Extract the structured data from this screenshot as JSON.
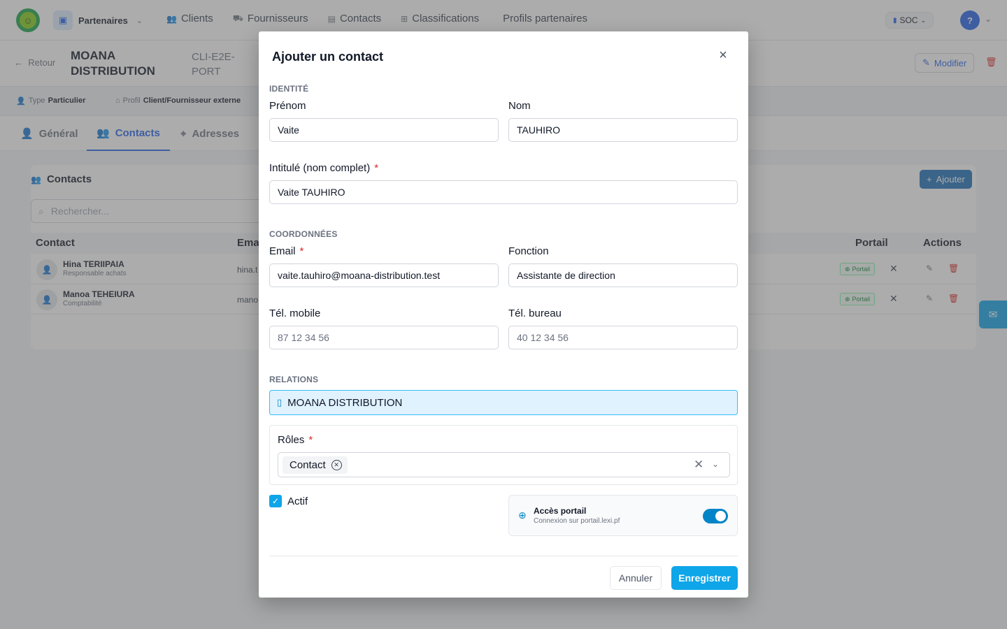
{
  "nav": {
    "logo_glyph": "☺",
    "module_label": "Partenaires",
    "links": [
      {
        "label": "Clients",
        "icon": "users-icon"
      },
      {
        "label": "Fournisseurs",
        "icon": "truck-icon"
      },
      {
        "label": "Contacts",
        "icon": "id-card-icon"
      },
      {
        "label": "Classifications",
        "icon": "sitemap-icon"
      },
      {
        "label": "Profils partenaires",
        "icon": ""
      }
    ],
    "company_switch": "SOC",
    "help_label": "?"
  },
  "header": {
    "back_label": "Retour",
    "company_name": "MOANA DISTRIBUTION",
    "company_code": "CLI-E2E-PORT",
    "modify_label": "Modifier"
  },
  "meta": {
    "type_label": "Type",
    "type_value": "Particulier",
    "profile_label": "Profil",
    "profile_value": "Client/Fournisseur externe"
  },
  "tabs": [
    {
      "label": "Général",
      "active": false
    },
    {
      "label": "Contacts",
      "active": true
    },
    {
      "label": "Adresses",
      "active": false
    }
  ],
  "contacts_panel": {
    "title": "Contacts",
    "add_label": "Ajouter",
    "search_placeholder": "Rechercher...",
    "columns": {
      "contact": "Contact",
      "email": "Ema",
      "portal": "Portail",
      "actions": "Actions"
    },
    "rows": [
      {
        "name": "Hina TERIIPAIA",
        "role": "Responsable achats",
        "email": "hina.t",
        "portal": "Portail"
      },
      {
        "name": "Manoa TEHEIURA",
        "role": "Comptabilité",
        "email": "mano",
        "portal": "Portail"
      }
    ]
  },
  "modal": {
    "title": "Ajouter un contact",
    "identity_section": "IDENTITÉ",
    "first_name_label": "Prénom",
    "first_name_value": "Vaite",
    "last_name_label": "Nom",
    "last_name_value": "TAUHIRO",
    "full_name_label": "Intitulé (nom complet)",
    "full_name_value": "Vaite TAUHIRO",
    "coords_section": "COORDONNÉES",
    "email_label": "Email",
    "email_value": "vaite.tauhiro@moana-distribution.test",
    "function_label": "Fonction",
    "function_value": "Assistante de direction",
    "mobile_label": "Tél. mobile",
    "mobile_placeholder": "87 12 34 56",
    "office_label": "Tél. bureau",
    "office_placeholder": "40 12 34 56",
    "relations_section": "RELATIONS",
    "relation_company": "MOANA DISTRIBUTION",
    "roles_label": "Rôles",
    "roles_selected": [
      "Contact"
    ],
    "active_label": "Actif",
    "active_checked": true,
    "portal_title": "Accès portail",
    "portal_subtitle": "Connexion sur portail.lexi.pf",
    "portal_enabled": true,
    "cancel_label": "Annuler",
    "save_label": "Enregistrer",
    "required_mark": "*"
  },
  "colors": {
    "primary": "#0ea5e9",
    "link_blue": "#2563eb",
    "danger": "#dc2626",
    "portal_badge": "#15803d"
  }
}
